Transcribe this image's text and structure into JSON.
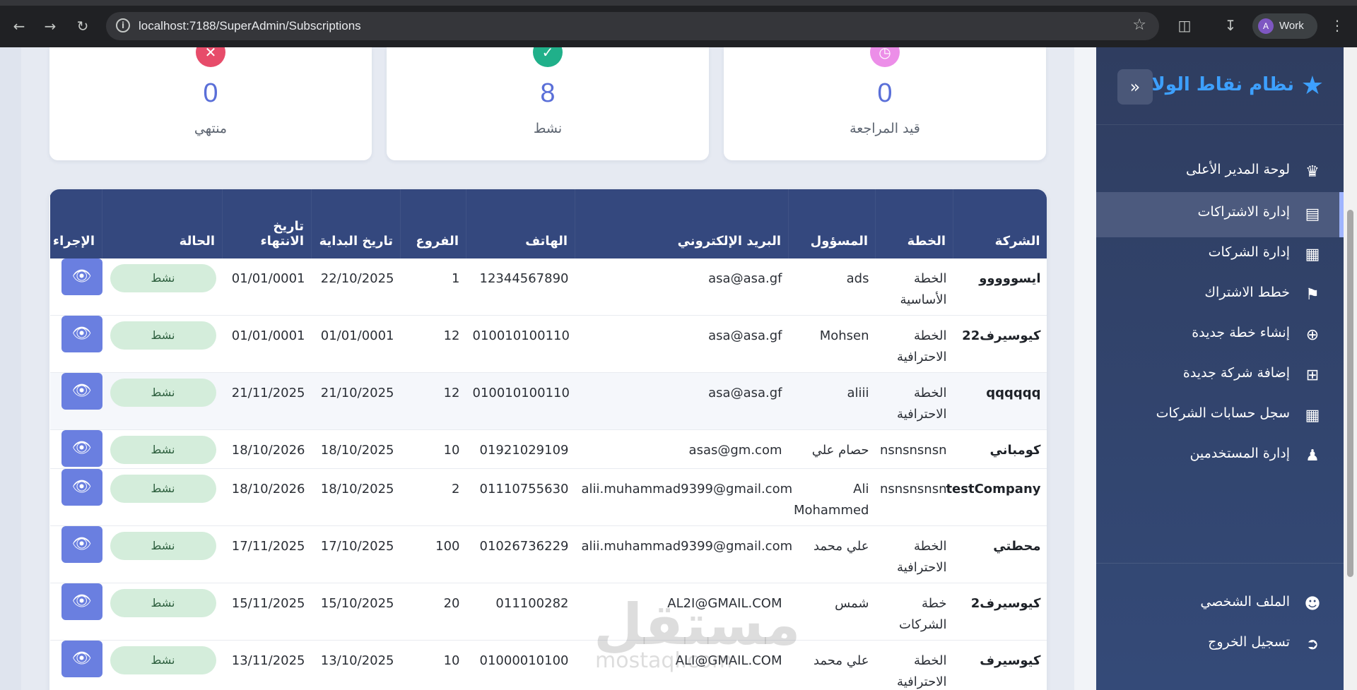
{
  "browser": {
    "url": "localhost:7188/SuperAdmin/Subscriptions",
    "profile_initial": "A",
    "profile_label": "Work"
  },
  "stats": [
    {
      "value": "0",
      "label": "منتهي",
      "icon": "x-icon",
      "color": "#e74c6a"
    },
    {
      "value": "8",
      "label": "نشط",
      "icon": "check-icon",
      "color": "#20b08a"
    },
    {
      "value": "0",
      "label": "قيد المراجعة",
      "icon": "clock-icon",
      "color": "#ec8ee8"
    }
  ],
  "table": {
    "headers": {
      "company": "الشركة",
      "plan": "الخطة",
      "manager": "المسؤول",
      "email": "البريد الإلكتروني",
      "phone": "الهاتف",
      "branches": "الفروع",
      "start": "تاريخ البداية",
      "end": "تاريخ الانتهاء",
      "status": "الحالة",
      "action": "الإجراء"
    },
    "rows": [
      {
        "company": "ايسووووو",
        "plan": "الخطة الأساسية",
        "manager": "ads",
        "email": "asa@asa.gf",
        "phone": "12344567890",
        "branches": "1",
        "start": "22/10/2025",
        "end": "01/01/0001",
        "status": "نشط"
      },
      {
        "company": "كيوسيرف22",
        "plan": "الخطة الاحترافية",
        "manager": "Mohsen",
        "email": "asa@asa.gf",
        "phone": "010010100110",
        "branches": "12",
        "start": "01/01/0001",
        "end": "01/01/0001",
        "status": "نشط"
      },
      {
        "company": "qqqqqq",
        "plan": "الخطة الاحترافية",
        "manager": "aliii",
        "email": "asa@asa.gf",
        "phone": "010010100110",
        "branches": "12",
        "start": "21/10/2025",
        "end": "21/11/2025",
        "status": "نشط"
      },
      {
        "company": "كومباني",
        "plan": "nsnsnsnsn",
        "manager": "حصام علي",
        "email": "asas@gm.com",
        "phone": "01921029109",
        "branches": "10",
        "start": "18/10/2025",
        "end": "18/10/2026",
        "status": "نشط"
      },
      {
        "company": "testCompany",
        "plan": "nsnsnsnsn",
        "manager": "Ali Mohammed",
        "email": "alii.muhammad9399@gmail.com",
        "phone": "01110755630",
        "branches": "2",
        "start": "18/10/2025",
        "end": "18/10/2026",
        "status": "نشط"
      },
      {
        "company": "محطتي",
        "plan": "الخطة الاحترافية",
        "manager": "علي محمد",
        "email": "alii.muhammad9399@gmail.com",
        "phone": "01026736229",
        "branches": "100",
        "start": "17/10/2025",
        "end": "17/11/2025",
        "status": "نشط"
      },
      {
        "company": "كيوسيرف2",
        "plan": "خطة الشركات",
        "manager": "شمس",
        "email": "AL2I@GMAIL.COM",
        "phone": "011100282",
        "branches": "20",
        "start": "15/10/2025",
        "end": "15/11/2025",
        "status": "نشط"
      },
      {
        "company": "كيوسيرف",
        "plan": "الخطة الاحترافية",
        "manager": "علي محمد",
        "email": "ALI@GMAIL.COM",
        "phone": "01000010100",
        "branches": "10",
        "start": "13/10/2025",
        "end": "13/11/2025",
        "status": "نشط"
      }
    ]
  },
  "sidebar": {
    "title": "نظام نقاط الولاء",
    "items": [
      {
        "label": "لوحة المدير الأعلى",
        "icon": "crown-icon"
      },
      {
        "label": "إدارة الاشتراكات",
        "icon": "file-icon",
        "active": true
      },
      {
        "label": "إدارة الشركات",
        "icon": "building-icon"
      },
      {
        "label": "خطط الاشتراك",
        "icon": "tags-icon"
      },
      {
        "label": "إنشاء خطة جديدة",
        "icon": "plus-circle-icon"
      },
      {
        "label": "إضافة شركة جديدة",
        "icon": "plus-square-icon"
      },
      {
        "label": "سجل حسابات الشركات",
        "icon": "clipboard-icon"
      },
      {
        "label": "إدارة المستخدمين",
        "icon": "users-icon"
      }
    ],
    "bottom_items": [
      {
        "label": "الملف الشخصي",
        "icon": "user-circle-icon"
      },
      {
        "label": "تسجيل الخروج",
        "icon": "logout-icon"
      }
    ]
  },
  "watermark": {
    "text": "مستقل",
    "subtext": "mostaql.com"
  }
}
